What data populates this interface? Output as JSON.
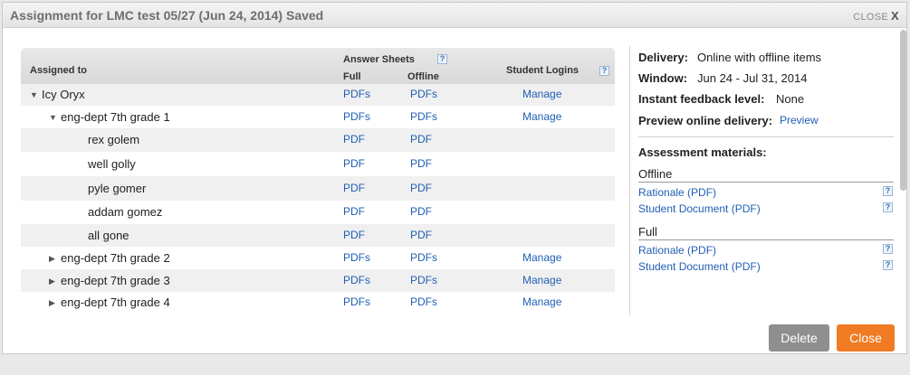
{
  "dialog": {
    "title": "Assignment for LMC test 05/27 (Jun 24, 2014) Saved",
    "close_label": "CLOSE",
    "close_x": "X"
  },
  "table": {
    "headers": {
      "assigned_to": "Assigned to",
      "answer_sheets": "Answer Sheets",
      "full": "Full",
      "offline": "Offline",
      "student_logins": "Student Logins",
      "help": "?"
    },
    "rows": [
      {
        "expander": "▼",
        "name": "Icy Oryx",
        "full": "PDFs",
        "offline": "PDFs",
        "login": "Manage"
      },
      {
        "expander": "▼",
        "name": "eng-dept 7th grade 1",
        "full": "PDFs",
        "offline": "PDFs",
        "login": "Manage"
      },
      {
        "expander": "",
        "name": "rex golem",
        "full": "PDF",
        "offline": "PDF",
        "login": ""
      },
      {
        "expander": "",
        "name": "well golly",
        "full": "PDF",
        "offline": "PDF",
        "login": ""
      },
      {
        "expander": "",
        "name": "pyle gomer",
        "full": "PDF",
        "offline": "PDF",
        "login": ""
      },
      {
        "expander": "",
        "name": "addam gomez",
        "full": "PDF",
        "offline": "PDF",
        "login": ""
      },
      {
        "expander": "",
        "name": "all gone",
        "full": "PDF",
        "offline": "PDF",
        "login": ""
      },
      {
        "expander": "▶",
        "name": "eng-dept 7th grade 2",
        "full": "PDFs",
        "offline": "PDFs",
        "login": "Manage"
      },
      {
        "expander": "▶",
        "name": "eng-dept 7th grade 3",
        "full": "PDFs",
        "offline": "PDFs",
        "login": "Manage"
      },
      {
        "expander": "▶",
        "name": "eng-dept 7th grade 4",
        "full": "PDFs",
        "offline": "PDFs",
        "login": "Manage"
      }
    ]
  },
  "details": {
    "delivery_label": "Delivery:",
    "delivery_value": "Online with offline items",
    "window_label": "Window:",
    "window_value": "Jun 24 - Jul 31, 2014",
    "feedback_label": "Instant feedback level:",
    "feedback_value": "None",
    "preview_label": "Preview online delivery:",
    "preview_link": "Preview",
    "materials_label": "Assessment materials:",
    "offline_heading": "Offline",
    "offline_items": [
      "Rationale (PDF)",
      "Student Document (PDF)"
    ],
    "full_heading": "Full",
    "full_items": [
      "Rationale (PDF)",
      "Student Document (PDF)"
    ],
    "help": "?"
  },
  "buttons": {
    "delete": "Delete",
    "close": "Close"
  },
  "colors": {
    "link": "#1f5fb5",
    "close_button": "#f07b22",
    "delete_button": "#8f8f8f"
  }
}
